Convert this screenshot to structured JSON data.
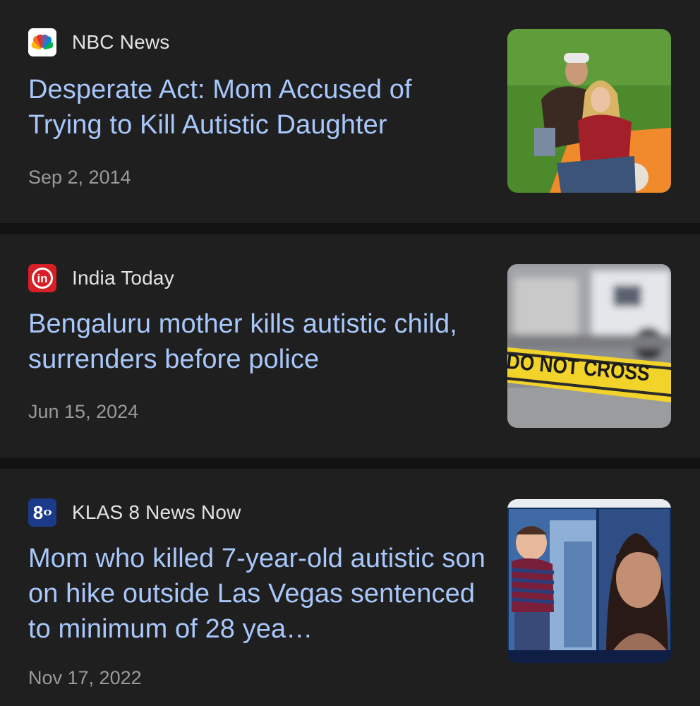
{
  "articles": [
    {
      "source": "NBC News",
      "source_icon": "nbc-peacock-icon",
      "headline": "Desperate Act: Mom Accused of Trying to Kill Autistic Daughter",
      "date": "Sep 2, 2014"
    },
    {
      "source": "India Today",
      "source_icon": "india-today-logo-icon",
      "source_icon_text": "in",
      "headline": "Bengaluru mother kills autistic child, surrenders before police",
      "date": "Jun 15, 2024",
      "thumbnail_text": "DO NOT CROSS"
    },
    {
      "source": "KLAS 8 News Now",
      "source_icon": "klas-8-logo-icon",
      "source_icon_text": "8",
      "headline": "Mom who killed 7-year-old autistic son on hike outside Las Vegas sentenced to minimum of 28 yea…",
      "date": "Nov 17, 2022"
    }
  ],
  "colors": {
    "background": "#1f1f1f",
    "separator": "#131313",
    "headline": "#a8c7fa",
    "source_text": "#e3e3e3",
    "date_text": "#9a9a9a"
  }
}
